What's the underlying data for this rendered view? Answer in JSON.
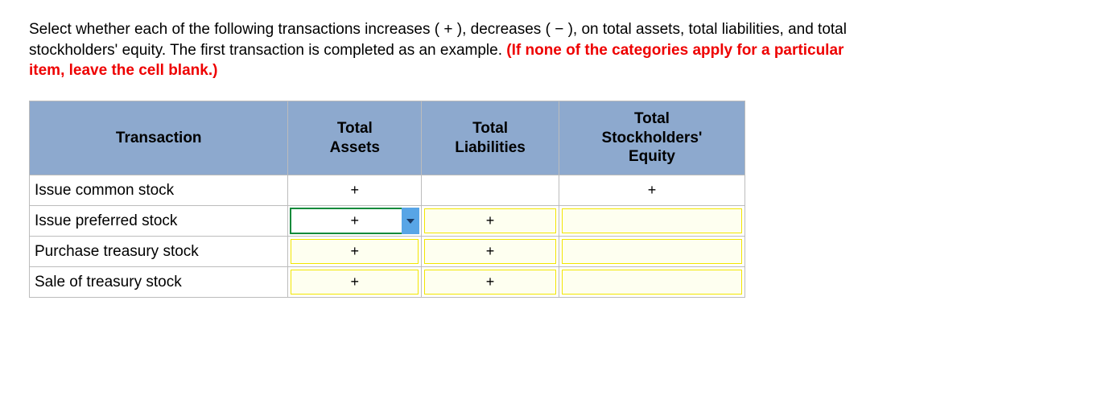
{
  "instructions": {
    "text_main": "Select whether each of the following transactions increases ( + ), decreases ( − ), on total assets, total liabilities, and total stockholders' equity. The first transaction is completed as an example. ",
    "text_red": "(If none of the categories apply for a particular item, leave the cell blank.)"
  },
  "table": {
    "headers": {
      "transaction": "Transaction",
      "assets": "Total Assets",
      "liabilities": "Total Liabilities",
      "equity": "Total Stockholders' Equity"
    },
    "rows": [
      {
        "label": "Issue common stock",
        "assets": "+",
        "liabilities": "",
        "equity": "+",
        "style": {
          "assets": "plain",
          "liabilities": "plain",
          "equity": "plain"
        }
      },
      {
        "label": "Issue preferred stock",
        "assets": "+",
        "liabilities": "+",
        "equity": "",
        "style": {
          "assets": "active",
          "liabilities": "yellow",
          "equity": "yellow"
        }
      },
      {
        "label": "Purchase treasury stock",
        "assets": "+",
        "liabilities": "+",
        "equity": "",
        "style": {
          "assets": "yellow",
          "liabilities": "yellow",
          "equity": "yellow"
        }
      },
      {
        "label": "Sale of treasury stock",
        "assets": "+",
        "liabilities": "+",
        "equity": "",
        "style": {
          "assets": "yellow",
          "liabilities": "yellow",
          "equity": "yellow"
        }
      }
    ]
  }
}
